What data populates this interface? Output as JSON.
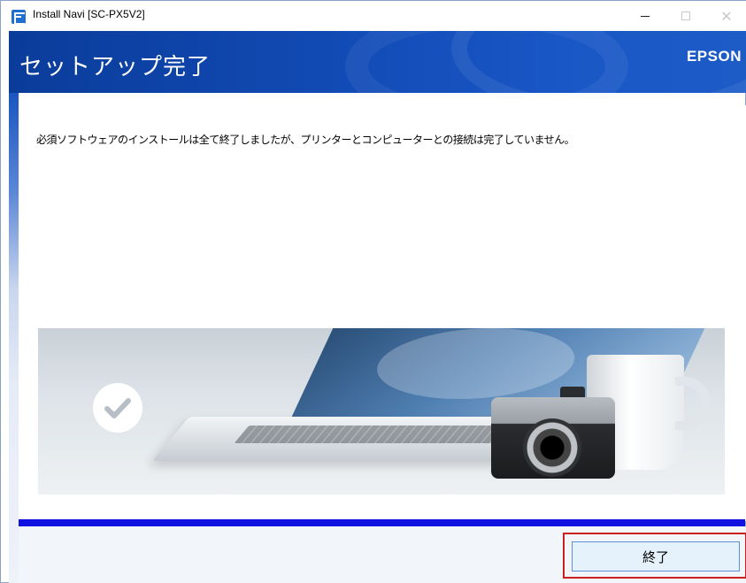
{
  "window": {
    "title": "Install Navi [SC-PX5V2]",
    "controls": {
      "minimize": "—",
      "maximize": "☐",
      "close": "✕"
    }
  },
  "header": {
    "title": "セットアップ完了",
    "brand": "EPSON"
  },
  "main": {
    "message": "必須ソフトウェアのインストールは全て終了しましたが、プリンターとコンピューターとの接続は完了していません。",
    "illustration_icon": "check-circle-icon"
  },
  "progress": {
    "value": 1.0
  },
  "footer": {
    "finish_label": "終了"
  },
  "colors": {
    "banner": "#124bb5",
    "progress": "#1010e0",
    "highlight": "#cc1f1f"
  }
}
